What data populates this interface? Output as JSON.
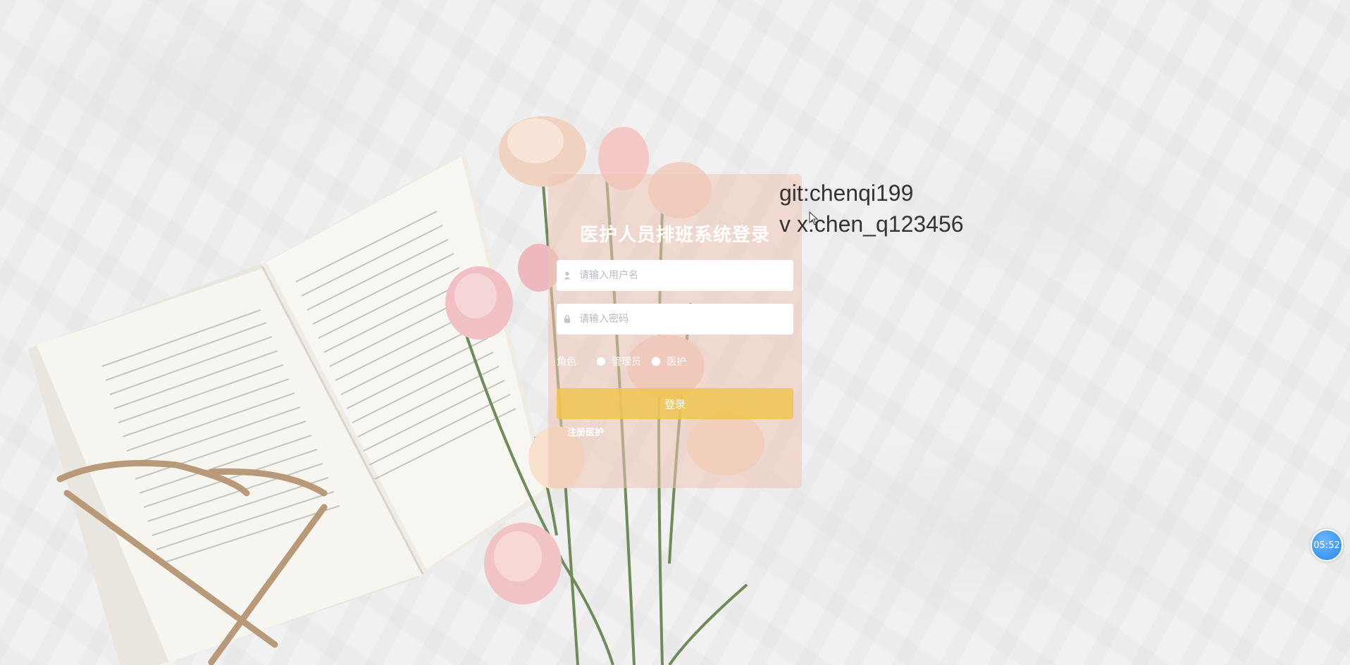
{
  "login": {
    "title": "医护人员排班系统登录",
    "username_placeholder": "请输入用户名",
    "password_placeholder": "请输入密码",
    "role_label": "角色",
    "roles": [
      {
        "label": "管理员"
      },
      {
        "label": "医护"
      }
    ],
    "login_button": "登录",
    "register_link": "注册医护"
  },
  "notes": {
    "git": "git:chenqi199",
    "wechat": "v x:chen_q123456"
  },
  "timer": {
    "value": "05:52"
  },
  "colors": {
    "card_bg": "#eec4b4",
    "button_bg": "#f0c450",
    "timer_bg": "#2b86e8"
  }
}
